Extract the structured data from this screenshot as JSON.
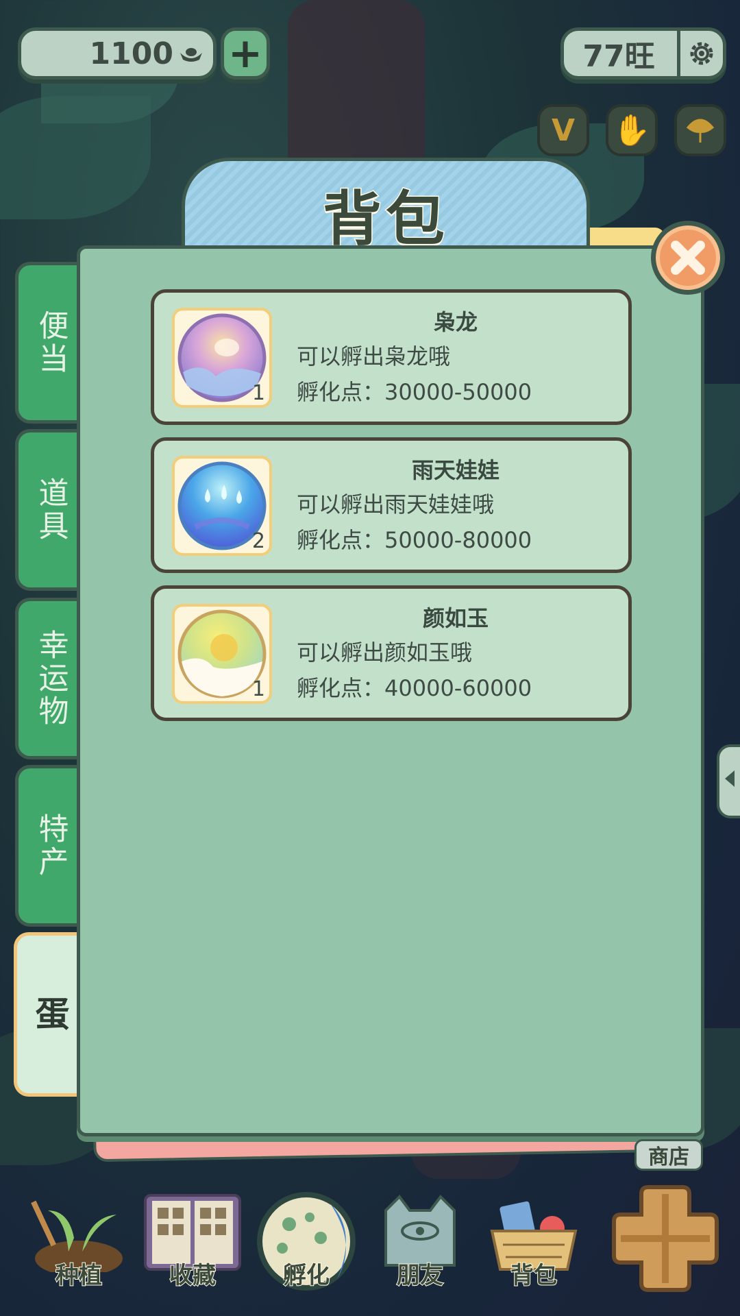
{
  "top_bar": {
    "coins": "1100",
    "wang": "77旺"
  },
  "panel": {
    "title": "背包"
  },
  "tabs": [
    {
      "label": "便当",
      "active": false
    },
    {
      "label": "道具",
      "active": false
    },
    {
      "label": "幸运物",
      "active": false
    },
    {
      "label": "特产",
      "active": false
    },
    {
      "label": "蛋",
      "active": true
    }
  ],
  "items": [
    {
      "name": "枭龙",
      "desc": "可以孵出枭龙哦",
      "points": "孵化点：30000-50000",
      "count": "1",
      "icon": "purple-egg-icon"
    },
    {
      "name": "雨天娃娃",
      "desc": "可以孵出雨天娃娃哦",
      "points": "孵化点：50000-80000",
      "count": "2",
      "icon": "blue-raindrop-egg-icon"
    },
    {
      "name": "颜如玉",
      "desc": "可以孵出颜如玉哦",
      "points": "孵化点：40000-60000",
      "count": "1",
      "icon": "yellow-jade-egg-icon"
    }
  ],
  "bottom_nav": [
    {
      "label": "种植"
    },
    {
      "label": "收藏"
    },
    {
      "label": "孵化"
    },
    {
      "label": "朋友"
    },
    {
      "label": "背包"
    }
  ],
  "shop": {
    "label": "商店"
  },
  "colors": {
    "panel_green": "#94c4aa",
    "tab_green": "#3fa86a",
    "card_bg": "#c3e0cb",
    "title_blue": "#a3d3ea",
    "close_orange": "#f19b66"
  }
}
